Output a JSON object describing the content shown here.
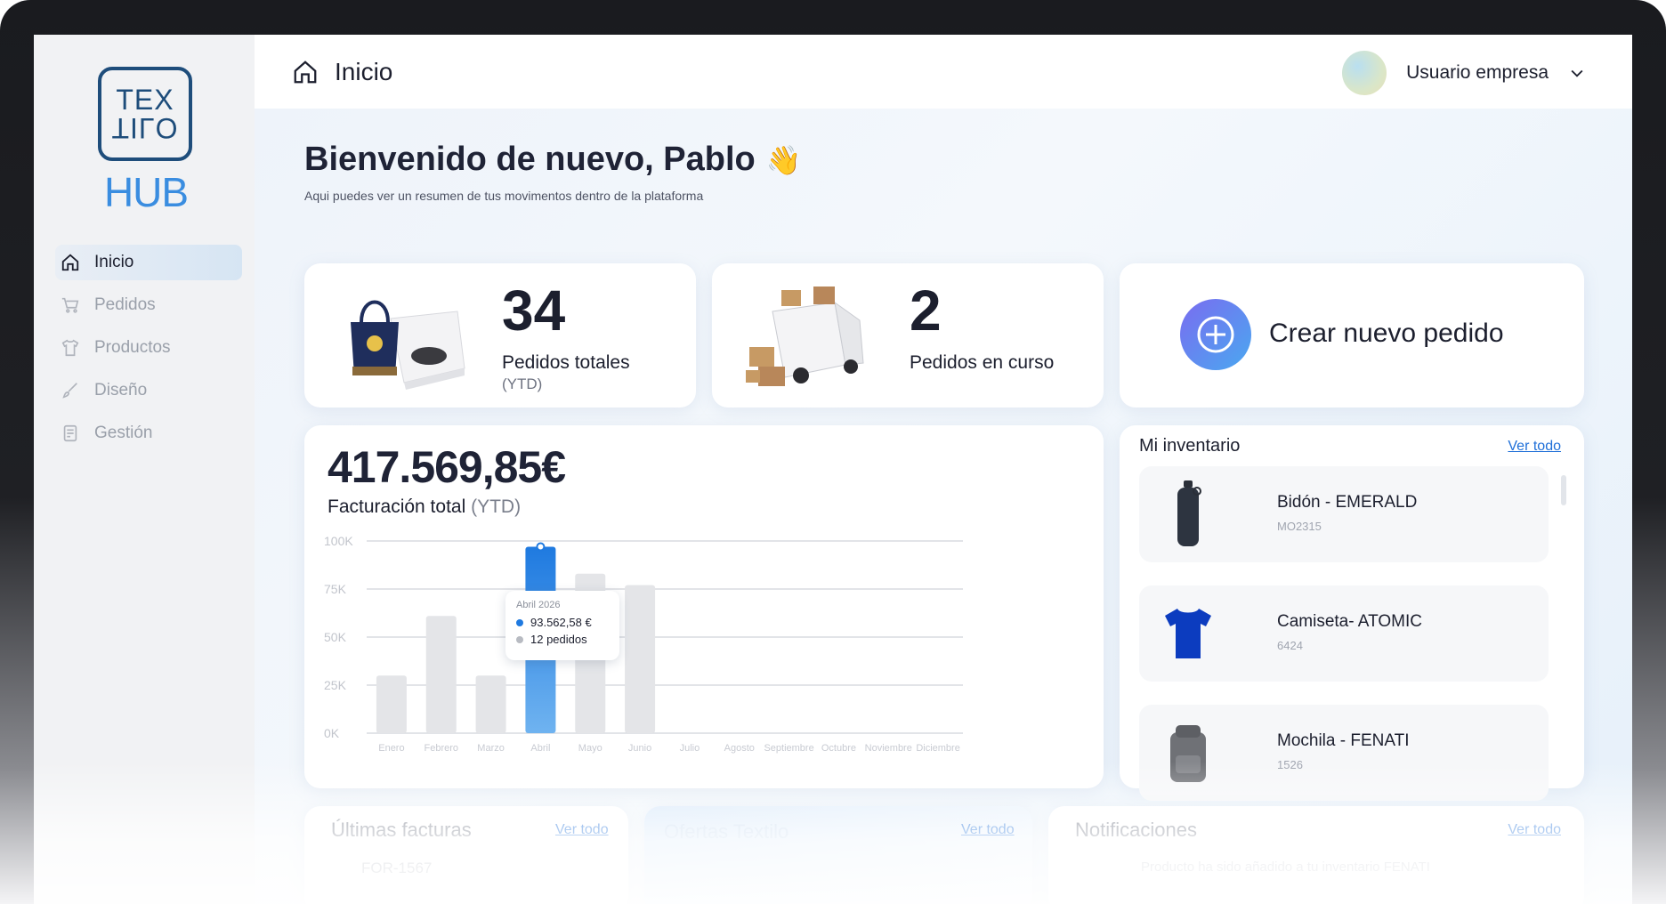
{
  "sidebar": {
    "logo_top": "TEX",
    "logo_bottom": "TILO",
    "logo_hub": "HUB",
    "items": [
      {
        "label": "Inicio",
        "icon": "home-icon",
        "active": true
      },
      {
        "label": "Pedidos",
        "icon": "cart-icon",
        "active": false
      },
      {
        "label": "Productos",
        "icon": "shirt-icon",
        "active": false
      },
      {
        "label": "Diseño",
        "icon": "brush-icon",
        "active": false
      },
      {
        "label": "Gestión",
        "icon": "document-icon",
        "active": false
      }
    ]
  },
  "header": {
    "title": "Inicio",
    "user_name": "Usuario empresa"
  },
  "welcome": {
    "title": "Bienvenido de nuevo, Pablo",
    "emoji": "👋",
    "subtitle": "Aqui puedes ver un resumen de tus movimentos dentro de la plataforma"
  },
  "stats": {
    "total_orders": {
      "value": "34",
      "label": "Pedidos totales",
      "sub": "(YTD)"
    },
    "orders_in_progress": {
      "value": "2",
      "label": "Pedidos en curso"
    },
    "create_order_label": "Crear nuevo pedido"
  },
  "revenue": {
    "value": "417.569,85€",
    "label": "Facturación total",
    "label_sub": "(YTD)"
  },
  "chart_data": {
    "type": "bar",
    "categories": [
      "Enero",
      "Febrero",
      "Marzo",
      "Abril",
      "Mayo",
      "Junio",
      "Julio",
      "Agosto",
      "Septiembre",
      "Octubre",
      "Noviembre",
      "Diciembre"
    ],
    "values": [
      30000,
      61000,
      30000,
      97000,
      83000,
      77000,
      0,
      0,
      0,
      0,
      0,
      0
    ],
    "y_ticks": [
      "0K",
      "25K",
      "50K",
      "75K",
      "100K"
    ],
    "ylim": [
      0,
      100000
    ],
    "highlight_index": 3,
    "highlight_color": "#1f7ae0",
    "bar_color": "#e4e5e8",
    "tooltip": {
      "title": "Abril 2026",
      "amount": "93.562,58 €",
      "orders": "12 pedidos"
    }
  },
  "inventory": {
    "title": "Mi inventario",
    "see_all": "Ver todo",
    "items": [
      {
        "name": "Bidón - EMERALD",
        "code": "MO2315",
        "icon": "bottle-icon"
      },
      {
        "name": "Camiseta- ATOMIC",
        "code": "6424",
        "icon": "tshirt-icon"
      },
      {
        "name": "Mochila - FENATI",
        "code": "1526",
        "icon": "backpack-icon"
      }
    ]
  },
  "bottom": {
    "invoices_title": "Últimas facturas",
    "invoices_see_all": "Ver todo",
    "invoice_first": "FOR-1567",
    "offers_title": "Ofertas Textilo",
    "offers_see_all": "Ver todo",
    "notifications_title": "Notificaciones",
    "notifications_see_all": "Ver todo",
    "notification_first": "Producto ha sido añadido a tu inventario FENATI"
  },
  "colors": {
    "accent": "#1f7ae0",
    "brand_dark": "#1e4d7b",
    "brand_light": "#3a8de0"
  }
}
